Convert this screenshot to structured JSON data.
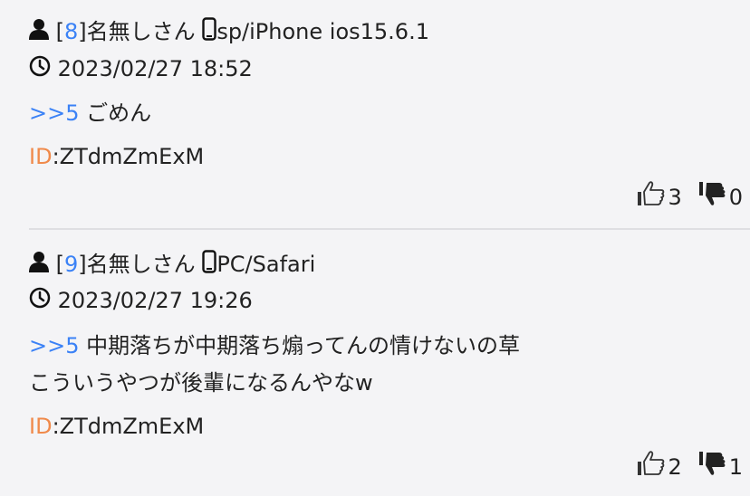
{
  "posts": [
    {
      "number": "8",
      "name": "名無しさん",
      "device": "sp/iPhone ios15.6.1",
      "datetime": "2023/02/27 18:52",
      "anchor": ">>5",
      "body_lines": [
        "ごめん"
      ],
      "id_label": "ID",
      "id_value": ":ZTdmZmExM",
      "likes": "3",
      "dislikes": "0"
    },
    {
      "number": "9",
      "name": "名無しさん",
      "device": "PC/Safari",
      "datetime": "2023/02/27 19:26",
      "anchor": ">>5",
      "body_lines": [
        "中期落ちが中期落ち煽ってんの情けないの草",
        "こういうやつが後輩になるんやなw"
      ],
      "id_label": "ID",
      "id_value": ":ZTdmZmExM",
      "likes": "2",
      "dislikes": "1"
    }
  ],
  "brackets": {
    "open": "[",
    "close": "]"
  }
}
